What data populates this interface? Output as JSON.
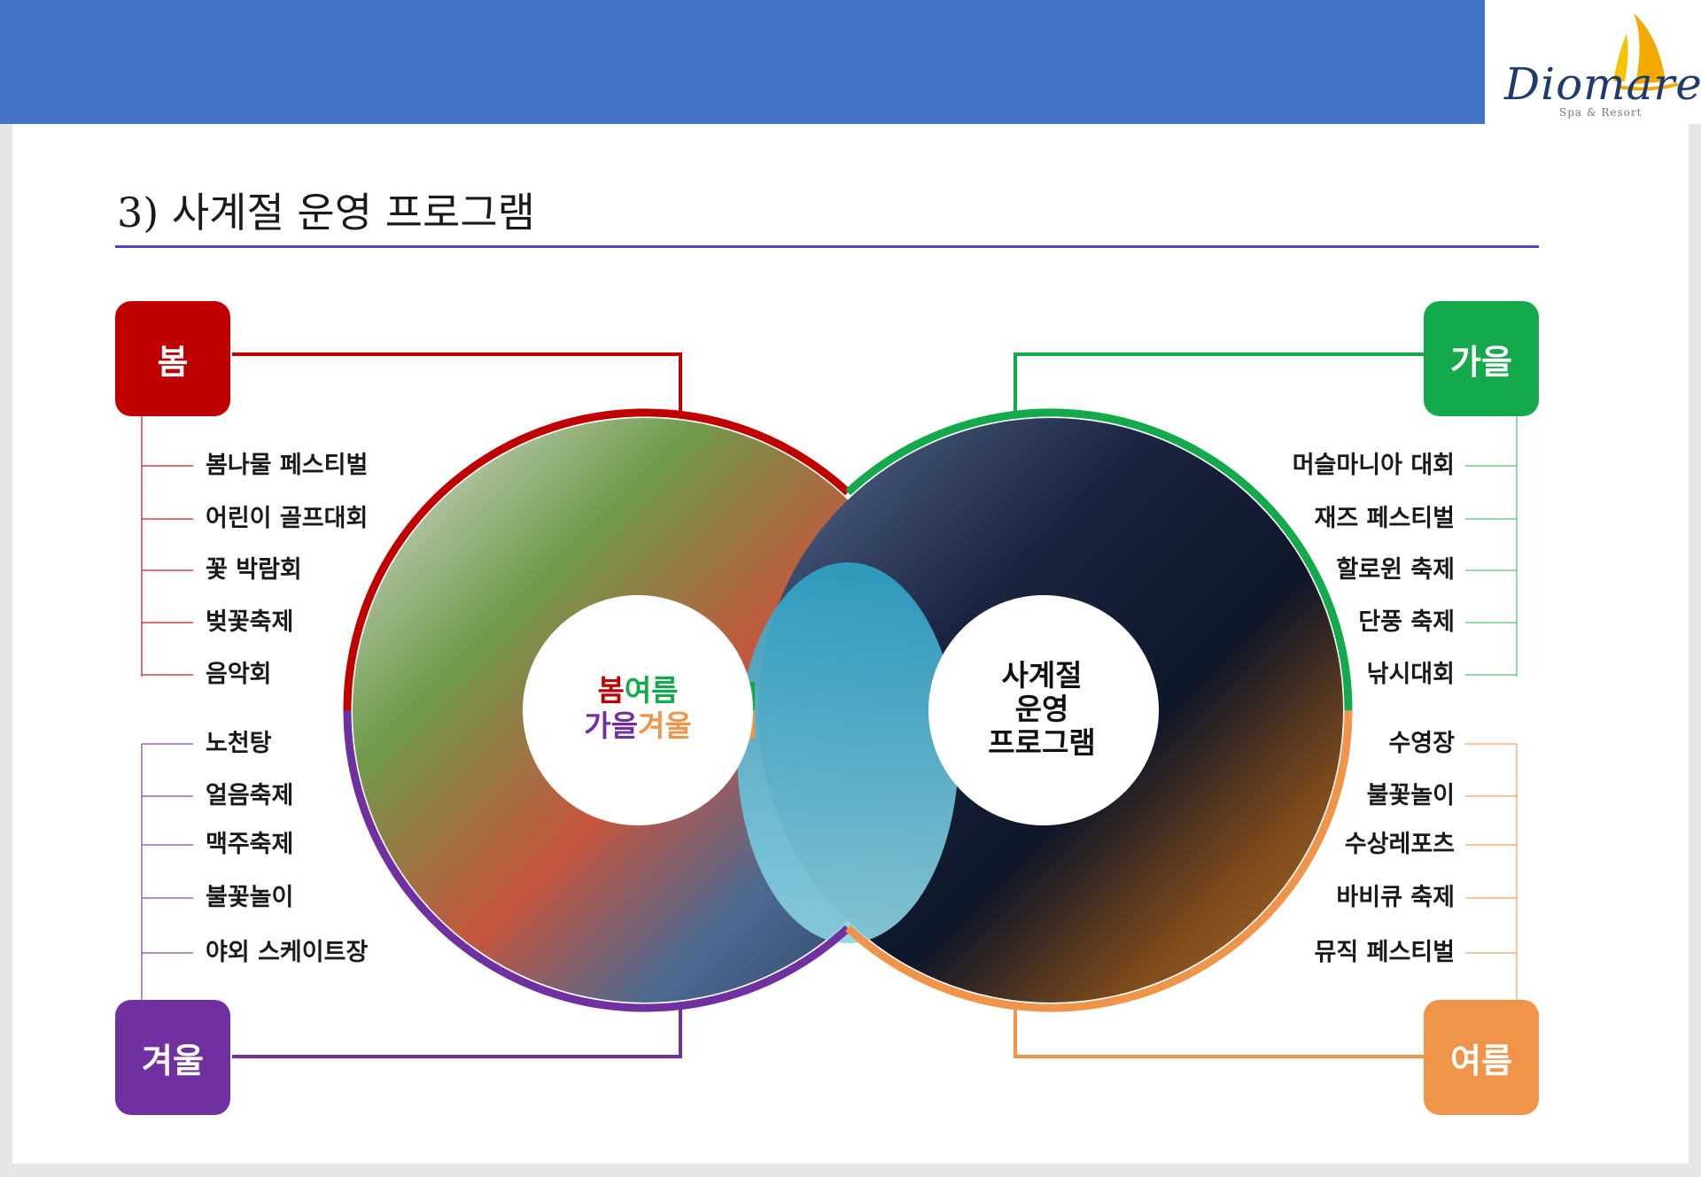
{
  "logo": {
    "name": "Diomare",
    "tagline": "Spa & Resort"
  },
  "title": "3) 사계절 운영 프로그램",
  "seasons": {
    "spring": {
      "label": "봄",
      "color": "#c00000",
      "items": [
        "봄나물 페스티벌",
        "어린이 골프대회",
        "꽃 박람회",
        "벚꽃축제",
        "음악회"
      ]
    },
    "fall": {
      "label": "가을",
      "color": "#14a94a",
      "items": [
        "머슬마니아 대회",
        "재즈 페스티벌",
        "할로윈 축제",
        "단풍 축제",
        "낚시대회"
      ]
    },
    "winter": {
      "label": "겨울",
      "color": "#7030a0",
      "items": [
        "노천탕",
        "얼음축제",
        "맥주축제",
        "불꽃놀이",
        "야외 스케이트장"
      ]
    },
    "summer": {
      "label": "여름",
      "color": "#f0944a",
      "items": [
        "수영장",
        "불꽃놀이",
        "수상레포츠",
        "바비큐 축제",
        "뮤직 페스티벌"
      ]
    }
  },
  "center_left": {
    "w1": "봄",
    "w2": "여름",
    "w3": "가을",
    "w4": "겨울"
  },
  "center_right": {
    "line1": "사계절",
    "line2": "운영",
    "line3": "프로그램"
  }
}
